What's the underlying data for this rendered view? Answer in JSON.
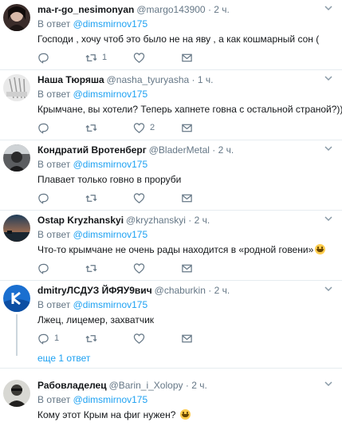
{
  "replies": [
    {
      "name": "ma-r-go_nesimonyan",
      "handle": "@margo143900",
      "dot": "·",
      "time": "2 ч.",
      "reply_label": "В ответ",
      "reply_to": "@dimsmirnov175",
      "text": "Господи , хочу чтоб это было не на яву , а как кошмарный сон (",
      "reply_count": "",
      "retweet_count": "1",
      "like_count": ""
    },
    {
      "name": "Наша Тюряша",
      "handle": "@nasha_tyuryasha",
      "dot": "·",
      "time": "1 ч.",
      "reply_label": "В ответ",
      "reply_to": "@dimsmirnov175",
      "text": "Крымчане, вы хотели? Теперь хапнете говна с остальной страной?)))",
      "reply_count": "",
      "retweet_count": "",
      "like_count": "2"
    },
    {
      "name": "Кондратий Вротенберг",
      "handle": "@BladerMetal",
      "dot": "·",
      "time": "2 ч.",
      "reply_label": "В ответ",
      "reply_to": "@dimsmirnov175",
      "text": "Плавает только говно в проруби",
      "reply_count": "",
      "retweet_count": "",
      "like_count": ""
    },
    {
      "name": "Ostap Kryzhanskyi",
      "handle": "@kryzhanskyi",
      "dot": "·",
      "time": "2 ч.",
      "reply_label": "В ответ",
      "reply_to": "@dimsmirnov175",
      "text": "Что-то крымчане не очень рады находится в «родной говени»",
      "reply_count": "",
      "retweet_count": "",
      "like_count": ""
    },
    {
      "name": "dmitryЛСДУЗ ЙФЯУ9вич",
      "handle": "@chaburkin",
      "dot": "·",
      "time": "2 ч.",
      "reply_label": "В ответ",
      "reply_to": "@dimsmirnov175",
      "text": "Лжец, лицемер, захватчик",
      "reply_count": "1",
      "retweet_count": "",
      "like_count": "",
      "more_replies": "еще 1 ответ"
    },
    {
      "name": "Рабовладелец",
      "handle": "@Barin_i_Xolopy",
      "dot": "·",
      "time": "2 ч.",
      "reply_label": "В ответ",
      "reply_to": "@dimsmirnov175",
      "text": "Кому этот Крым на фиг нужен?",
      "reply_count": "",
      "retweet_count": "",
      "like_count": ""
    }
  ],
  "icons": {
    "reply": "reply-icon",
    "retweet": "retweet-icon",
    "like": "heart-icon",
    "dm": "envelope-icon",
    "caret": "chevron-down-icon",
    "emoji": "laughing-emoji-icon"
  },
  "colors": {
    "link": "#1da1f2",
    "text": "#14171a",
    "muted": "#657786",
    "border": "#e6ecf0",
    "thread_line": "#ccd6dd"
  }
}
